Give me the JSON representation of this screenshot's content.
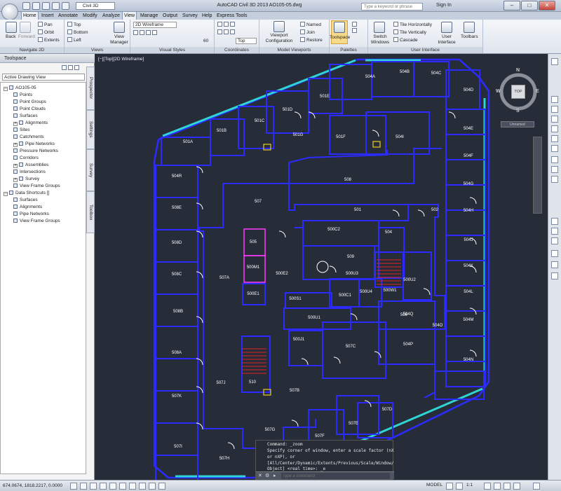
{
  "titlebar": {
    "workspace": "Civil 3D",
    "title": "AutoCAD Civil 3D 2013     AO105-05.dwg",
    "search_placeholder": "Type a keyword or phrase",
    "signin": "Sign In",
    "minimize": "–",
    "maximize": "□",
    "close": "✕"
  },
  "tabs": [
    {
      "label": "Home"
    },
    {
      "label": "Insert"
    },
    {
      "label": "Annotate"
    },
    {
      "label": "Modify"
    },
    {
      "label": "Analyze"
    },
    {
      "label": "View"
    },
    {
      "label": "Manage"
    },
    {
      "label": "Output"
    },
    {
      "label": "Survey"
    },
    {
      "label": "Help"
    },
    {
      "label": "Express Tools"
    }
  ],
  "ribbon": {
    "navigate": {
      "title": "Navigate 2D",
      "back": "Back",
      "forward": "Forward",
      "pan": "Pan",
      "orbit": "Orbit",
      "extents": "Extents"
    },
    "views": {
      "title": "Views",
      "top": "Top",
      "bottom": "Bottom",
      "left": "Left",
      "manager": "View Manager"
    },
    "visual": {
      "title": "Visual Styles",
      "style": "2D Wireframe",
      "value": "60"
    },
    "coordinates": {
      "title": "Coordinates",
      "ucs": "Top"
    },
    "modelvp": {
      "title": "Model Viewports",
      "config": "Viewport Configuration",
      "named": "Named",
      "join": "Join",
      "restore": "Restore"
    },
    "palettes": {
      "title": "Palettes",
      "toolspace": "Toolspace"
    },
    "ui": {
      "title": "User Interface",
      "switch": "Switch Windows",
      "th": "Tile Horizontally",
      "tv": "Tile Vertically",
      "cascade": "Cascade",
      "userif": "User Interface",
      "toolbars": "Toolbars"
    }
  },
  "toolspace": {
    "title": "Toolspace",
    "dropdown": "Active Drawing View",
    "tree": [
      {
        "label": "AO105-05",
        "level": 0,
        "exp": "−"
      },
      {
        "label": "Points",
        "level": 1
      },
      {
        "label": "Point Groups",
        "level": 1
      },
      {
        "label": "Point Clouds",
        "level": 1
      },
      {
        "label": "Surfaces",
        "level": 1
      },
      {
        "label": "Alignments",
        "level": 1,
        "exp": "+"
      },
      {
        "label": "Sites",
        "level": 1
      },
      {
        "label": "Catchments",
        "level": 1
      },
      {
        "label": "Pipe Networks",
        "level": 1,
        "exp": "+"
      },
      {
        "label": "Pressure Networks",
        "level": 1
      },
      {
        "label": "Corridors",
        "level": 1
      },
      {
        "label": "Assemblies",
        "level": 1,
        "exp": "+"
      },
      {
        "label": "Intersections",
        "level": 1
      },
      {
        "label": "Survey",
        "level": 1,
        "exp": "+"
      },
      {
        "label": "View Frame Groups",
        "level": 1
      },
      {
        "label": "Data Shortcuts []",
        "level": 0,
        "exp": "−"
      },
      {
        "label": "Surfaces",
        "level": 1
      },
      {
        "label": "Alignments",
        "level": 1
      },
      {
        "label": "Pipe Networks",
        "level": 1
      },
      {
        "label": "View Frame Groups",
        "level": 1
      }
    ],
    "side_tabs": [
      "Prospector",
      "Settings",
      "Survey",
      "Toolbox"
    ]
  },
  "viewport": {
    "label": "[−][Top][2D Wireframe]",
    "cube_top": "TOP",
    "n": "N",
    "s": "S",
    "e": "E",
    "w": "W",
    "wcs": "Unnamed"
  },
  "rooms": [
    {
      "label": "504A"
    },
    {
      "label": "504B"
    },
    {
      "label": "504C"
    },
    {
      "label": "504D"
    },
    {
      "label": "501E"
    },
    {
      "label": "501D"
    },
    {
      "label": "501C"
    },
    {
      "label": "501B"
    },
    {
      "label": "501A"
    },
    {
      "label": "501G"
    },
    {
      "label": "501F"
    },
    {
      "label": "504I"
    },
    {
      "label": "504E"
    },
    {
      "label": "504F"
    },
    {
      "label": "504G"
    },
    {
      "label": "504H"
    },
    {
      "label": "504J"
    },
    {
      "label": "504K"
    },
    {
      "label": "504L"
    },
    {
      "label": "504M"
    },
    {
      "label": "504N"
    },
    {
      "label": "504O"
    },
    {
      "label": "504P"
    },
    {
      "label": "504Q"
    },
    {
      "label": "504R"
    },
    {
      "label": "508E"
    },
    {
      "label": "508D"
    },
    {
      "label": "508C"
    },
    {
      "label": "508B"
    },
    {
      "label": "508A"
    },
    {
      "label": "507K"
    },
    {
      "label": "507J"
    },
    {
      "label": "507I"
    },
    {
      "label": "507H"
    },
    {
      "label": "507G"
    },
    {
      "label": "507F"
    },
    {
      "label": "507E"
    },
    {
      "label": "507D"
    },
    {
      "label": "507C"
    },
    {
      "label": "507B"
    },
    {
      "label": "507A"
    },
    {
      "label": "507"
    },
    {
      "label": "508"
    },
    {
      "label": "501"
    },
    {
      "label": "502"
    },
    {
      "label": "500C2"
    },
    {
      "label": "504"
    },
    {
      "label": "509"
    },
    {
      "label": "505"
    },
    {
      "label": "500M1"
    },
    {
      "label": "500E1"
    },
    {
      "label": "500E2"
    },
    {
      "label": "500U3"
    },
    {
      "label": "500C1"
    },
    {
      "label": "500U4"
    },
    {
      "label": "500W1"
    },
    {
      "label": "500U2"
    },
    {
      "label": "500S1"
    },
    {
      "label": "500U1"
    },
    {
      "label": "500J1"
    },
    {
      "label": "510"
    },
    {
      "label": "506"
    },
    {
      "label": "500S2"
    },
    {
      "label": "504S"
    }
  ],
  "command": {
    "line1": "Command: _zoom",
    "line2": "Specify corner of window, enter a scale factor (nX",
    "line3": "or nXP), or",
    "line4": "[All/Center/Dynamic/Extents/Previous/Scale/Window/",
    "line5": "Object] <real time>: _e",
    "placeholder": "Type a command"
  },
  "status": {
    "coords": "674.0674, 1818.2217, 0.0000",
    "model": "MODEL",
    "scale": "1:1"
  },
  "colors": {
    "wall": "#2b2bff",
    "canvas": "#272c39",
    "glass": "#2fd4d4",
    "stair": "#e02020",
    "highlight": "#ff3bff",
    "text": "#ffffff"
  }
}
